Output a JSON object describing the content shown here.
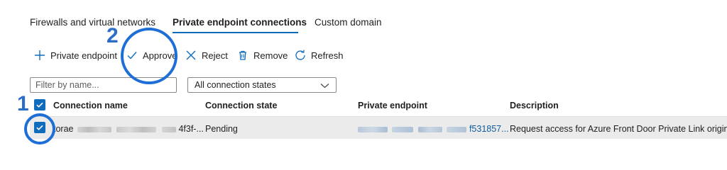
{
  "tabs": [
    {
      "label": "Firewalls and virtual networks",
      "active": false
    },
    {
      "label": "Private endpoint connections",
      "active": true
    },
    {
      "label": "Custom domain",
      "active": false
    }
  ],
  "toolbar": {
    "add_private_endpoint": {
      "label": "Private endpoint",
      "icon": "plus-icon"
    },
    "approve": {
      "label": "Approve",
      "icon": "checkmark-icon"
    },
    "reject": {
      "label": "Reject",
      "icon": "x-icon"
    },
    "remove": {
      "label": "Remove",
      "icon": "trash-icon"
    },
    "refresh": {
      "label": "Refresh",
      "icon": "refresh-icon"
    }
  },
  "filters": {
    "name_placeholder": "Filter by name...",
    "state_selected": "All connection states"
  },
  "table": {
    "columns": [
      "Connection name",
      "Connection state",
      "Private endpoint",
      "Description"
    ],
    "rows": [
      {
        "selected": true,
        "connection_name_prefix": "torae",
        "connection_name_suffix": "4f3f-...",
        "connection_state": "Pending",
        "private_endpoint_suffix": "f531857...",
        "description": "Request access for Azure Front Door Private Link origin"
      }
    ]
  },
  "annotations": [
    {
      "number": "1",
      "target": "row-checkbox"
    },
    {
      "number": "2",
      "target": "approve-button"
    }
  ],
  "colors": {
    "accent": "#0f6cbd",
    "annotation": "#1d6ed6",
    "row_highlight": "#ebebeb",
    "link": "#0f5b9e"
  }
}
